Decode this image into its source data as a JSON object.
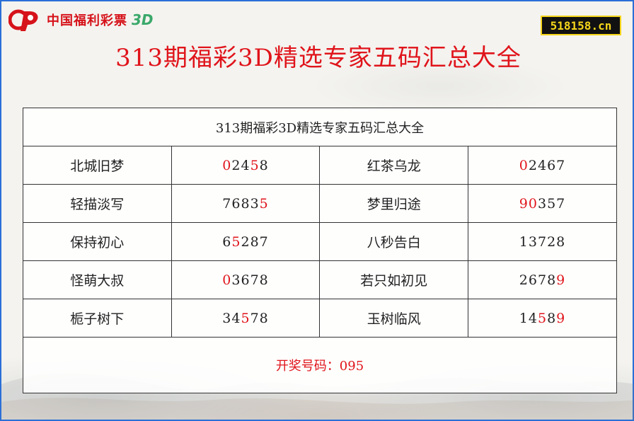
{
  "logo": {
    "text": "中国福利彩票",
    "suffix": "3D"
  },
  "site_badge": "518158.cn",
  "main_title": "313期福彩3D精选专家五码汇总大全",
  "table": {
    "header": "313期福彩3D精选专家五码汇总大全",
    "rows": [
      {
        "left": {
          "name": "北城旧梦",
          "digits": [
            "0",
            "2",
            "4",
            "5",
            "8"
          ],
          "hits": [
            true,
            false,
            false,
            true,
            false
          ]
        },
        "right": {
          "name": "红茶乌龙",
          "digits": [
            "0",
            "2",
            "4",
            "6",
            "7"
          ],
          "hits": [
            true,
            false,
            false,
            false,
            false
          ]
        }
      },
      {
        "left": {
          "name": "轻描淡写",
          "digits": [
            "7",
            "6",
            "8",
            "3",
            "5"
          ],
          "hits": [
            false,
            false,
            false,
            false,
            true
          ]
        },
        "right": {
          "name": "梦里归途",
          "digits": [
            "9",
            "0",
            "3",
            "5",
            "7"
          ],
          "hits": [
            true,
            true,
            false,
            false,
            false
          ]
        }
      },
      {
        "left": {
          "name": "保持初心",
          "digits": [
            "6",
            "5",
            "2",
            "8",
            "7"
          ],
          "hits": [
            false,
            true,
            false,
            false,
            false
          ]
        },
        "right": {
          "name": "八秒告白",
          "digits": [
            "1",
            "3",
            "7",
            "2",
            "8"
          ],
          "hits": [
            false,
            false,
            false,
            false,
            false
          ]
        }
      },
      {
        "left": {
          "name": "怪萌大叔",
          "digits": [
            "0",
            "3",
            "6",
            "7",
            "8"
          ],
          "hits": [
            true,
            false,
            false,
            false,
            false
          ]
        },
        "right": {
          "name": "若只如初见",
          "digits": [
            "2",
            "6",
            "7",
            "8",
            "9"
          ],
          "hits": [
            false,
            false,
            false,
            false,
            true
          ]
        }
      },
      {
        "left": {
          "name": "栀子树下",
          "digits": [
            "3",
            "4",
            "5",
            "7",
            "8"
          ],
          "hits": [
            false,
            false,
            true,
            false,
            false
          ]
        },
        "right": {
          "name": "玉树临风",
          "digits": [
            "1",
            "4",
            "5",
            "8",
            "9"
          ],
          "hits": [
            false,
            false,
            true,
            false,
            true
          ]
        }
      }
    ],
    "footer": "开奖号码：095"
  },
  "colors": {
    "accent": "#e0141b",
    "border": "#2a6fd6",
    "badge_bg": "#111111",
    "badge_fg": "#f5d51a",
    "logo_green": "#3aa86a"
  }
}
